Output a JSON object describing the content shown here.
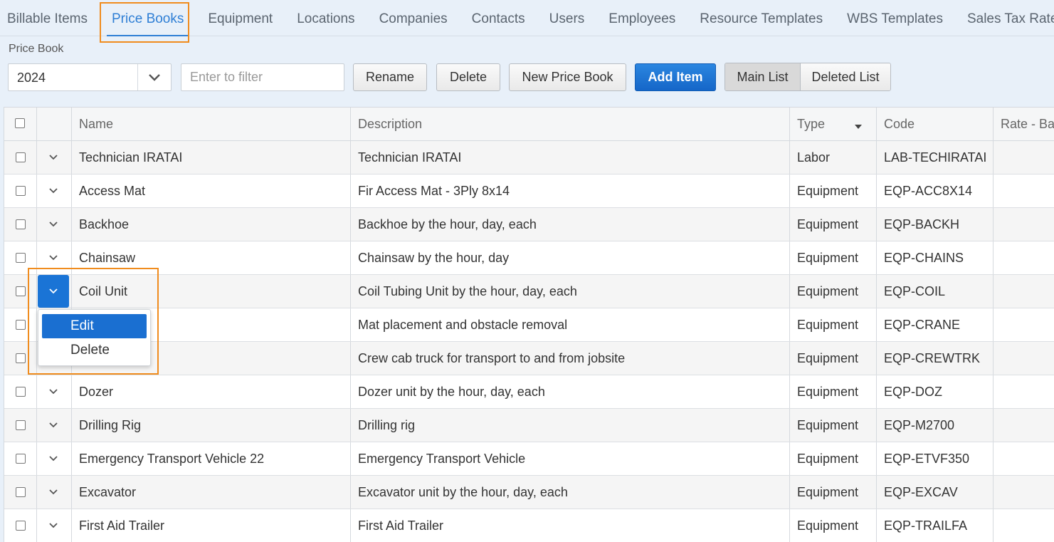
{
  "tabs": [
    "Billable Items",
    "Price Books",
    "Equipment",
    "Locations",
    "Companies",
    "Contacts",
    "Users",
    "Employees",
    "Resource Templates",
    "WBS Templates",
    "Sales Tax Rates"
  ],
  "toolbar": {
    "price_book_label": "Price Book",
    "price_book_value": "2024",
    "filter_placeholder": "Enter to filter",
    "rename": "Rename",
    "delete": "Delete",
    "new_price_book": "New Price Book",
    "add_item": "Add Item",
    "main_list": "Main List",
    "deleted_list": "Deleted List"
  },
  "columns": [
    "Name",
    "Description",
    "Type",
    "Code",
    "Rate - Bag"
  ],
  "rows": [
    {
      "name": "Technician IRATAI",
      "description": "Technician IRATAI",
      "type": "Labor",
      "code": "LAB-TECHIRATAI"
    },
    {
      "name": "Access Mat",
      "description": "Fir Access Mat - 3Ply 8x14",
      "type": "Equipment",
      "code": "EQP-ACC8X14"
    },
    {
      "name": "Backhoe",
      "description": "Backhoe by the hour, day, each",
      "type": "Equipment",
      "code": "EQP-BACKH"
    },
    {
      "name": "Chainsaw",
      "description": "Chainsaw by the hour, day",
      "type": "Equipment",
      "code": "EQP-CHAINS"
    },
    {
      "name": "Coil Unit",
      "description": "Coil Tubing Unit by the hour, day, each",
      "type": "Equipment",
      "code": "EQP-COIL"
    },
    {
      "name": "",
      "description": "Mat placement and obstacle removal",
      "type": "Equipment",
      "code": "EQP-CRANE"
    },
    {
      "name": "",
      "description": "Crew cab truck for transport to and from jobsite",
      "type": "Equipment",
      "code": "EQP-CREWTRK"
    },
    {
      "name": "Dozer",
      "description": "Dozer unit by the hour, day, each",
      "type": "Equipment",
      "code": "EQP-DOZ"
    },
    {
      "name": "Drilling Rig",
      "description": "Drilling rig",
      "type": "Equipment",
      "code": "EQP-M2700"
    },
    {
      "name": "Emergency Transport Vehicle 22",
      "description": "Emergency Transport Vehicle",
      "type": "Equipment",
      "code": "EQP-ETVF350"
    },
    {
      "name": "Excavator",
      "description": "Excavator unit by the hour, day, each",
      "type": "Equipment",
      "code": "EQP-EXCAV"
    },
    {
      "name": "First Aid Trailer",
      "description": "First Aid Trailer",
      "type": "Equipment",
      "code": "EQP-TRAILFA"
    }
  ],
  "context_menu": {
    "edit": "Edit",
    "delete": "Delete"
  },
  "colors": {
    "accent": "#2f7fd5",
    "highlight": "#f08c1e",
    "primary_button": "#1a74d6"
  }
}
